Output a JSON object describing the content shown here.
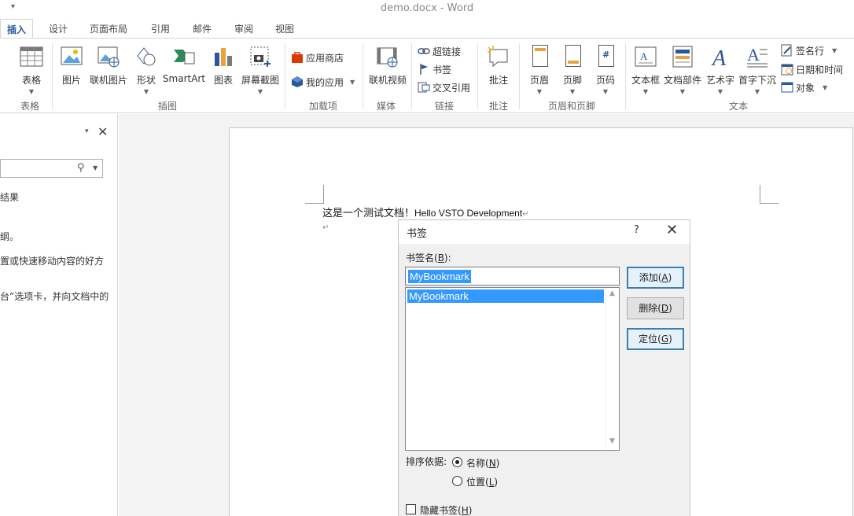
{
  "window": {
    "title": "demo.docx - Word",
    "qat_arrow": "▾"
  },
  "tabs": [
    {
      "label": "插入",
      "active": true
    },
    {
      "label": "设计"
    },
    {
      "label": "页面布局"
    },
    {
      "label": "引用"
    },
    {
      "label": "邮件"
    },
    {
      "label": "审阅"
    },
    {
      "label": "视图"
    }
  ],
  "ribbon": {
    "groups": {
      "tables": "表格",
      "illustrations": "插图",
      "addins": "加载项",
      "media": "媒体",
      "links": "链接",
      "comments": "批注",
      "header_footer": "页眉和页脚",
      "text": "文本"
    },
    "buttons": {
      "table": "表格",
      "pictures": "图片",
      "online_pictures": "联机图片",
      "shapes": "形状",
      "smartart": "SmartArt",
      "chart": "图表",
      "screenshot": "屏幕截图",
      "store": "应用商店",
      "my_apps": "我的应用",
      "online_video": "联机视频",
      "hyperlink": "超链接",
      "bookmark": "书签",
      "cross_reference": "交叉引用",
      "comment": "批注",
      "header": "页眉",
      "footer": "页脚",
      "page_number": "页码",
      "text_box": "文本框",
      "quick_parts": "文档部件",
      "wordart": "艺术字",
      "drop_cap": "首字下沉",
      "signature_line": "签名行",
      "date_time": "日期和时间",
      "object": "对象"
    },
    "colors": {
      "accent": "#2b579a",
      "store_red": "#d83b01"
    }
  },
  "nav_pane": {
    "close": "✕",
    "dropdown": "▾",
    "texts": [
      "结果",
      "纲。",
      "置或快速移动内容的好方",
      "台”选项卡，并向文档中的"
    ]
  },
  "document": {
    "line1_cn": "这是一个测试文档！",
    "line1_en": "Hello VSTO Development",
    "para_mark": "↵"
  },
  "dialog": {
    "title": "书签",
    "help": "?",
    "close": "✕",
    "name_label_text": "书签名(",
    "name_label_key": "B",
    "name_label_end": "):",
    "name_value": "MyBookmark",
    "list_items": [
      "MyBookmark"
    ],
    "buttons": {
      "add": {
        "text": "添加(",
        "key": "A",
        "end": ")"
      },
      "delete": {
        "text": "删除(",
        "key": "D",
        "end": ")"
      },
      "goto": {
        "text": "定位(",
        "key": "G",
        "end": ")"
      }
    },
    "sort_label": "排序依据:",
    "sort_name": {
      "text": "名称(",
      "key": "N",
      "end": ")"
    },
    "sort_location": {
      "text": "位置(",
      "key": "L",
      "end": ")"
    },
    "hidden": {
      "text": "隐藏书签(",
      "key": "H",
      "end": ")"
    }
  }
}
